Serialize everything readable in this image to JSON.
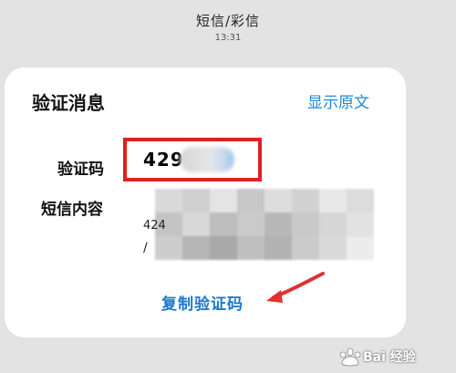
{
  "header": {
    "title": "短信/彩信",
    "time": "13:31"
  },
  "card": {
    "title": "验证消息",
    "show_original_label": "显示原文",
    "code_label": "验证码",
    "code_value": "429",
    "sms_label": "短信内容",
    "sms_line1": "424",
    "sms_line2": "/",
    "copy_button_label": "复制验证码"
  },
  "watermark": {
    "text": "Bai 经验"
  },
  "colors": {
    "accent_blue": "#1e88d6",
    "highlight_red": "#e02020",
    "arrow_red": "#e23030"
  }
}
